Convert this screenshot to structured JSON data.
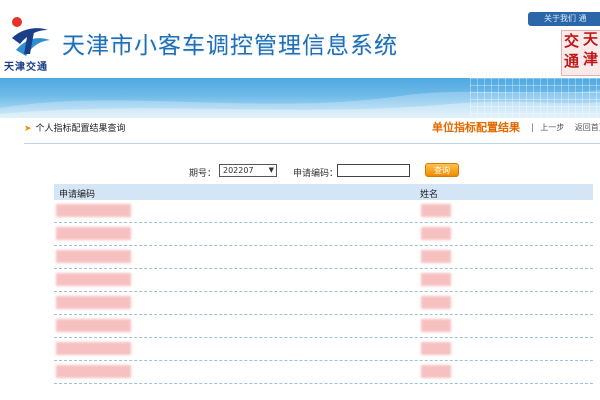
{
  "header": {
    "logo_text": "天津交通",
    "title": "天津市小客车调控管理信息系统",
    "top_tab": "关于我们  通",
    "seal_chars": [
      "天",
      "津",
      "交",
      "通"
    ]
  },
  "breadcrumb": {
    "label": "个人指标配置结果查询"
  },
  "right_nav": {
    "title": "单位指标配置结果",
    "sep": "|",
    "prev_link": "上一步",
    "home_link": "返回首页"
  },
  "form": {
    "period_label": "期号：",
    "period_value": "202207",
    "code_label": "申请编码：",
    "code_value": "",
    "query_button": "查询"
  },
  "table": {
    "columns": [
      "申请编码",
      "姓名"
    ],
    "rows": [
      {
        "code": "",
        "name": ""
      },
      {
        "code": "",
        "name": ""
      },
      {
        "code": "",
        "name": ""
      },
      {
        "code": "",
        "name": ""
      },
      {
        "code": "",
        "name": ""
      },
      {
        "code": "",
        "name": ""
      },
      {
        "code": "",
        "name": ""
      },
      {
        "code": "",
        "name": ""
      }
    ]
  },
  "colors": {
    "title_blue": "#1f6fb6",
    "accent_orange": "#e06a00",
    "header_row": "#d4e6f6",
    "redaction": "#f6b6b6"
  }
}
